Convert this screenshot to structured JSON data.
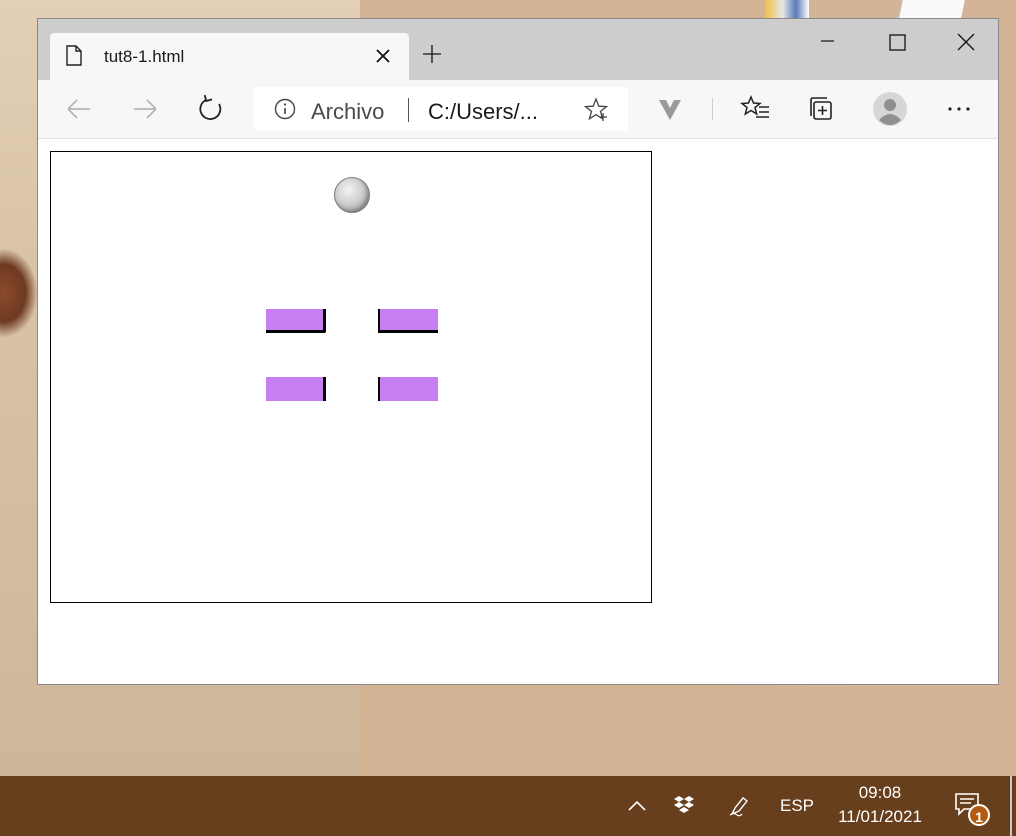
{
  "browser": {
    "tab": {
      "title": "tut8-1.html"
    },
    "address": {
      "site_label": "Archivo",
      "url": "C:/Users/..."
    }
  },
  "taskbar": {
    "language": "ESP",
    "time": "09:08",
    "date": "11/01/2021",
    "notification_count": "1"
  },
  "colors": {
    "block": "#c67ff2",
    "taskbar": "#673f1c"
  },
  "icons": [
    "document-icon",
    "close-icon",
    "plus-icon",
    "minimize-icon",
    "maximize-icon",
    "window-close-icon",
    "back-arrow-icon",
    "forward-arrow-icon",
    "refresh-icon",
    "info-icon",
    "favorite-star-icon",
    "extension-v-icon",
    "favorites-list-icon",
    "collections-icon",
    "profile-avatar-icon",
    "more-icon",
    "chevron-up-icon",
    "dropbox-icon",
    "pen-icon",
    "notification-icon"
  ]
}
